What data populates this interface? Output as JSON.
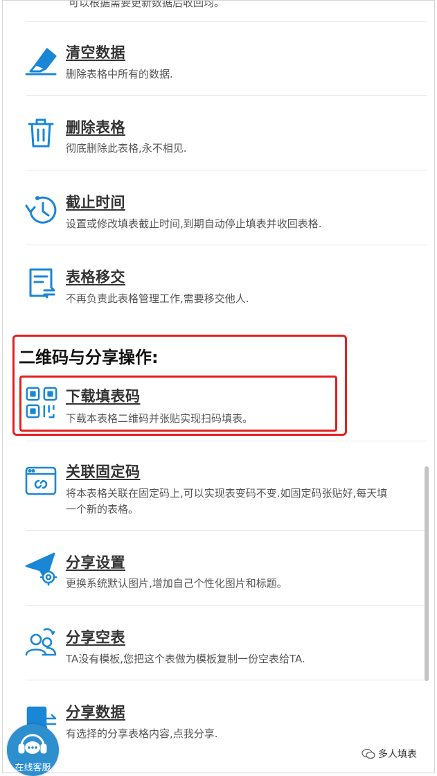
{
  "top_partial_text": "可以根据需要更新数据后收回均。",
  "items_a": [
    {
      "title": "清空数据",
      "desc": "删除表格中所有的数据.",
      "icon": "eraser-icon"
    },
    {
      "title": "删除表格",
      "desc": "彻底删除此表格,永不相见.",
      "icon": "trash-icon"
    },
    {
      "title": "截止时间",
      "desc": "设置或修改填表截止时间,到期自动停止填表并收回表格.",
      "icon": "clock-icon"
    },
    {
      "title": "表格移交",
      "desc": "不再负责此表格管理工作,需要移交他人.",
      "icon": "transfer-doc-icon"
    }
  ],
  "section_title": "二维码与分享操作:",
  "qr_item": {
    "title": "下载填表码",
    "desc": "下载本表格二维码并张贴实现扫码填表。",
    "icon": "qrcode-icon"
  },
  "items_b": [
    {
      "title": "关联固定码",
      "desc": "将本表格关联在固定码上,可以实现表变码不变.如固定码张贴好,每天填一个新的表格。",
      "icon": "link-window-icon"
    },
    {
      "title": "分享设置",
      "desc": "更换系统默认图片,增加自己个性化图片和标题。",
      "icon": "share-settings-icon"
    },
    {
      "title": "分享空表",
      "desc": "TA没有模板,您把这个表做为模板复制一份空表给TA.",
      "icon": "users-icon"
    },
    {
      "title": "分享数据",
      "desc": "有选择的分享表格内容,点我分享.",
      "icon": "share-data-icon"
    }
  ],
  "customer_service_label": "在线客服",
  "watermark_text": "多人填表",
  "colors": {
    "icon_blue": "#1a86d6",
    "highlight_red": "#e02020",
    "cs_blue": "#2e8fcf"
  }
}
